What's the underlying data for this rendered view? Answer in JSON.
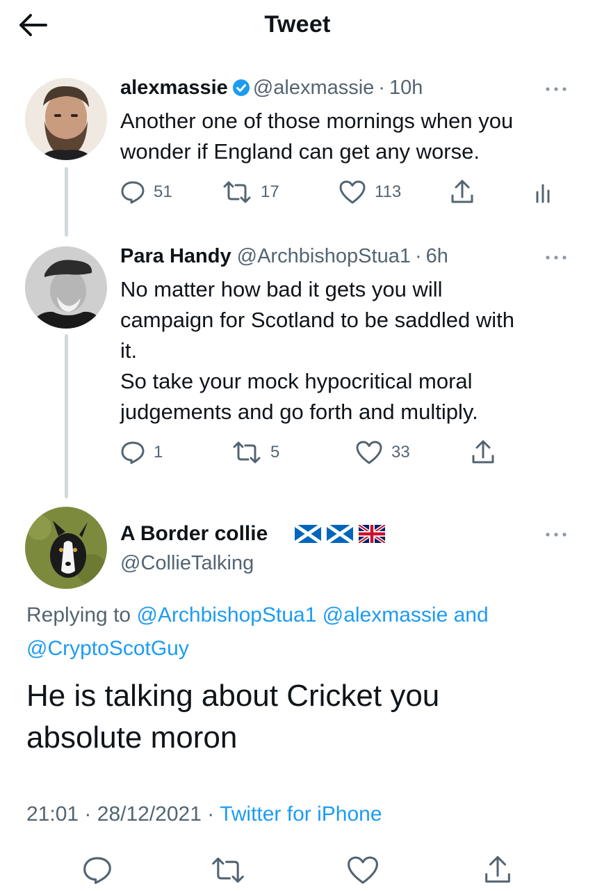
{
  "header": {
    "title": "Tweet"
  },
  "tweets": [
    {
      "name": "alexmassie",
      "handle": "@alexmassie",
      "sep": "·",
      "time": "10h",
      "text": "Another one of those mornings when you\nwonder if England can get any worse.",
      "replies": "51",
      "retweets": "17",
      "likes": "113"
    },
    {
      "name": "Para Handy",
      "handle": "@ArchbishopStua1",
      "sep": "·",
      "time": "6h",
      "text": "No matter how bad it gets you will\ncampaign for Scotland to be saddled with\nit.\nSo take your mock hypocritical moral\njudgements and go forth and multiply.",
      "replies": "1",
      "retweets": "5",
      "likes": "33"
    }
  ],
  "main_tweet": {
    "name": "A Border collie",
    "handle": "@CollieTalking",
    "replying_prefix": "Replying to",
    "mention1": "@ArchbishopStua1",
    "mention2": "@alexmassie",
    "mention_and": "and",
    "mention3": "@CryptoScotGuy",
    "text": "He is talking about Cricket you\nabsolute moron",
    "time": "21:01",
    "sep": "·",
    "date": "28/12/2021",
    "sep2": "·",
    "source": "Twitter for iPhone"
  },
  "icons": {
    "back": "arrow-left-icon",
    "verified": "verified-badge-icon",
    "more": "more-horizontal-icon",
    "reply": "reply-icon",
    "retweet": "retweet-icon",
    "like": "heart-icon",
    "share": "share-icon",
    "analytics": "analytics-icon",
    "flags": [
      "scotland-flag-icon",
      "scotland-flag-icon",
      "uk-flag-icon"
    ]
  },
  "colors": {
    "accent": "#1d9bf0",
    "text": "#0f1419",
    "secondary": "#536471",
    "thread_line": "#cfd9de"
  }
}
